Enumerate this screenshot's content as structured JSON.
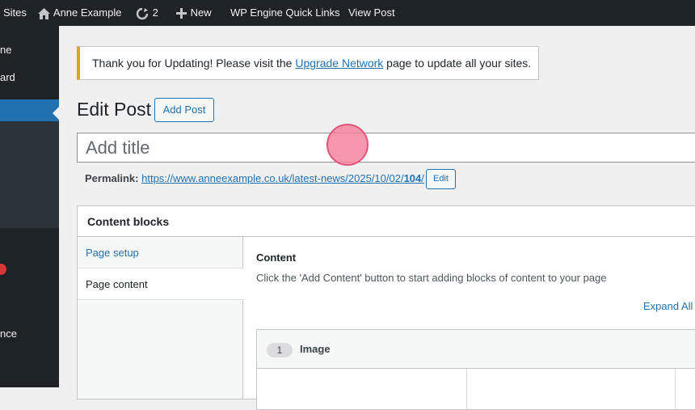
{
  "adminbar": {
    "sites_label": "Sites",
    "site_name": "Anne Example",
    "updates_count": "2",
    "new_label": "New",
    "quicklinks_label": "WP Engine Quick Links",
    "view_post_label": "View Post"
  },
  "sidebar": {
    "items": [
      "ne",
      "ard",
      "nce"
    ]
  },
  "notice": {
    "text_before": "Thank you for Updating! Please visit the ",
    "link_text": "Upgrade Network",
    "text_after": " page to update all your sites."
  },
  "heading": {
    "title": "Edit Post",
    "add_post_label": "Add Post"
  },
  "title_field": {
    "placeholder": "Add title"
  },
  "permalink": {
    "label": "Permalink:",
    "url_base": "https://www.anneexample.co.uk/latest-news/2025/10/02/",
    "url_slug": "104",
    "url_end": "/",
    "edit_label": "Edit"
  },
  "content_blocks": {
    "title": "Content blocks",
    "tabs": [
      "Page setup",
      "Page content"
    ],
    "content_label": "Content",
    "content_hint": "Click the 'Add Content' button to start adding blocks of content to your page",
    "expand_all": "Expand All",
    "block": {
      "number": "1",
      "title": "Image"
    }
  },
  "colors": {
    "admin_bar": "#1d2327",
    "accent": "#2271b1",
    "notice_border": "#dba617",
    "click_indicator": "#f4849e"
  }
}
